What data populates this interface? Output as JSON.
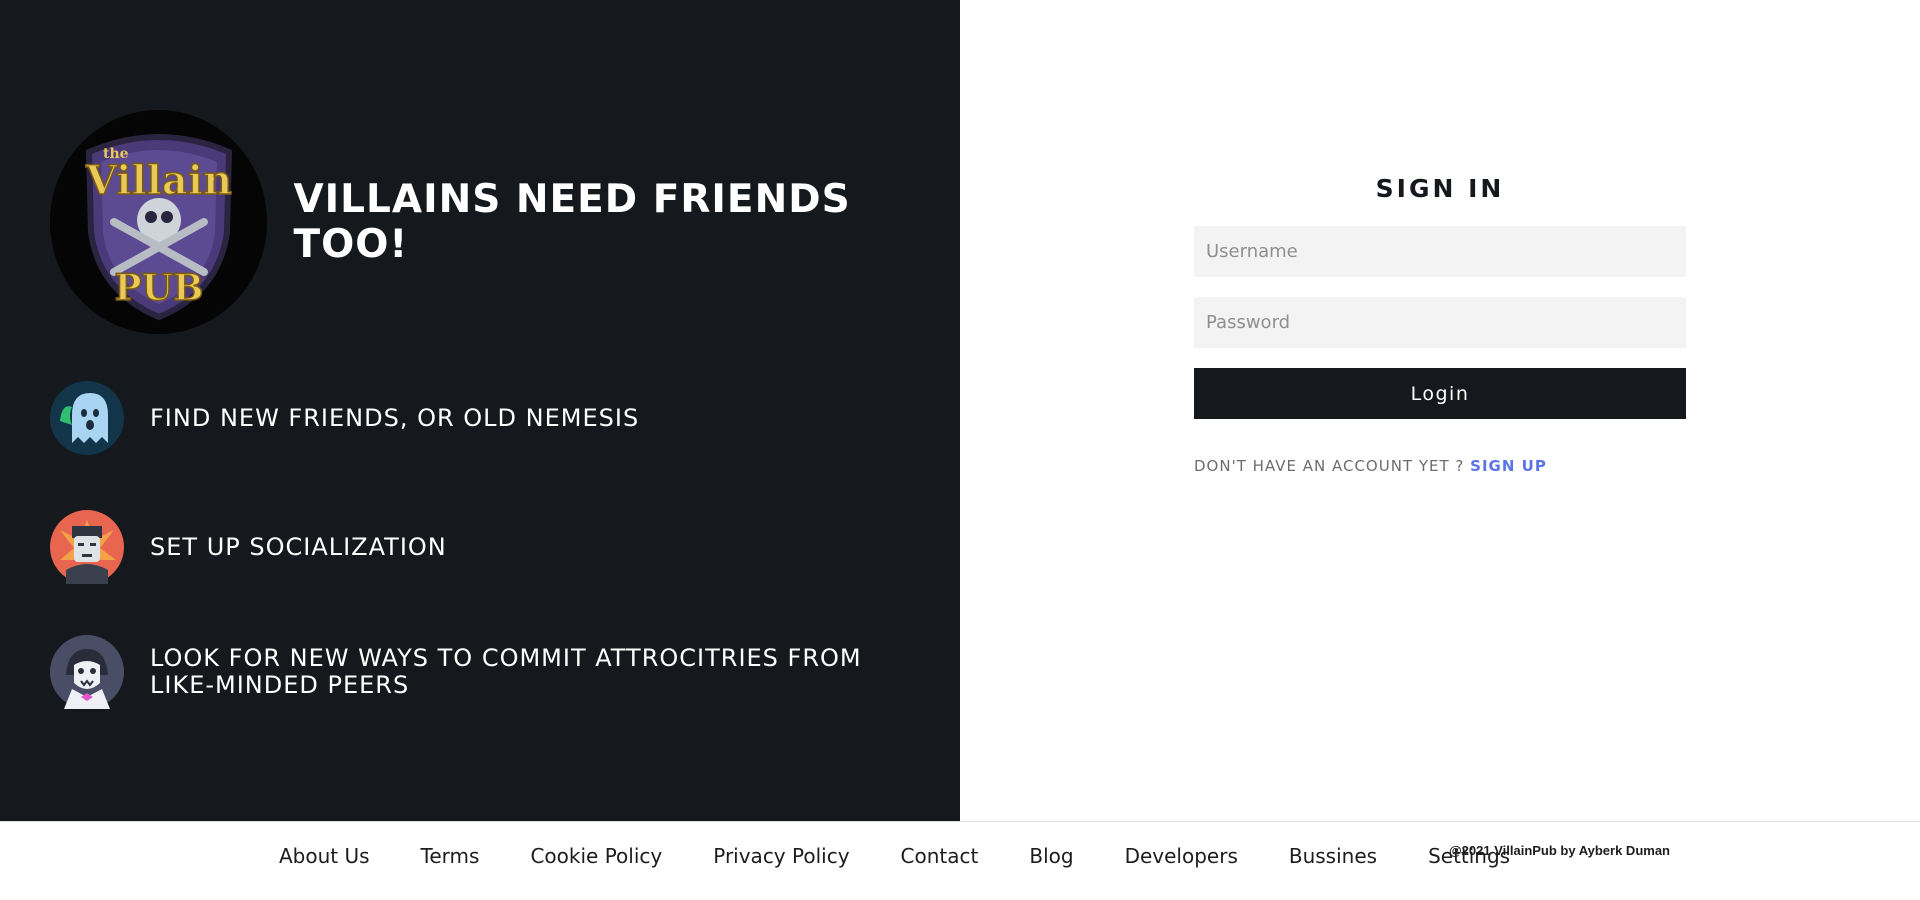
{
  "brand": {
    "logo_icon": "villain-pub-shield-logo",
    "logo_text_top": "the",
    "logo_text_main": "Villain",
    "logo_text_bottom": "PUB",
    "headline": "VILLAINS NEED FRIENDS TOO!"
  },
  "features": [
    {
      "icon": "ghost-icon",
      "text": "FIND NEW FRIENDS, OR OLD NEMESIS"
    },
    {
      "icon": "frankenstein-icon",
      "text": "SET UP SOCIALIZATION"
    },
    {
      "icon": "vampire-icon",
      "text": "LOOK FOR NEW WAYS TO COMMIT ATTROCITRIES FROM LIKE-MINDED PEERS"
    }
  ],
  "signin": {
    "title": "SIGN IN",
    "username_placeholder": "Username",
    "password_placeholder": "Password",
    "login_label": "Login",
    "no_account_text": "DON'T HAVE AN ACCOUNT YET ?",
    "signup_label": "SIGN UP"
  },
  "footer": {
    "links": [
      "About Us",
      "Terms",
      "Cookie Policy",
      "Privacy Policy",
      "Contact",
      "Blog",
      "Developers",
      "Bussines",
      "Settings"
    ],
    "copyright": "@2021 VillainPub by Ayberk Duman"
  },
  "colors": {
    "dark_panel": "#15181c",
    "accent_link": "#5b74e8",
    "input_bg": "#f3f3f3"
  }
}
